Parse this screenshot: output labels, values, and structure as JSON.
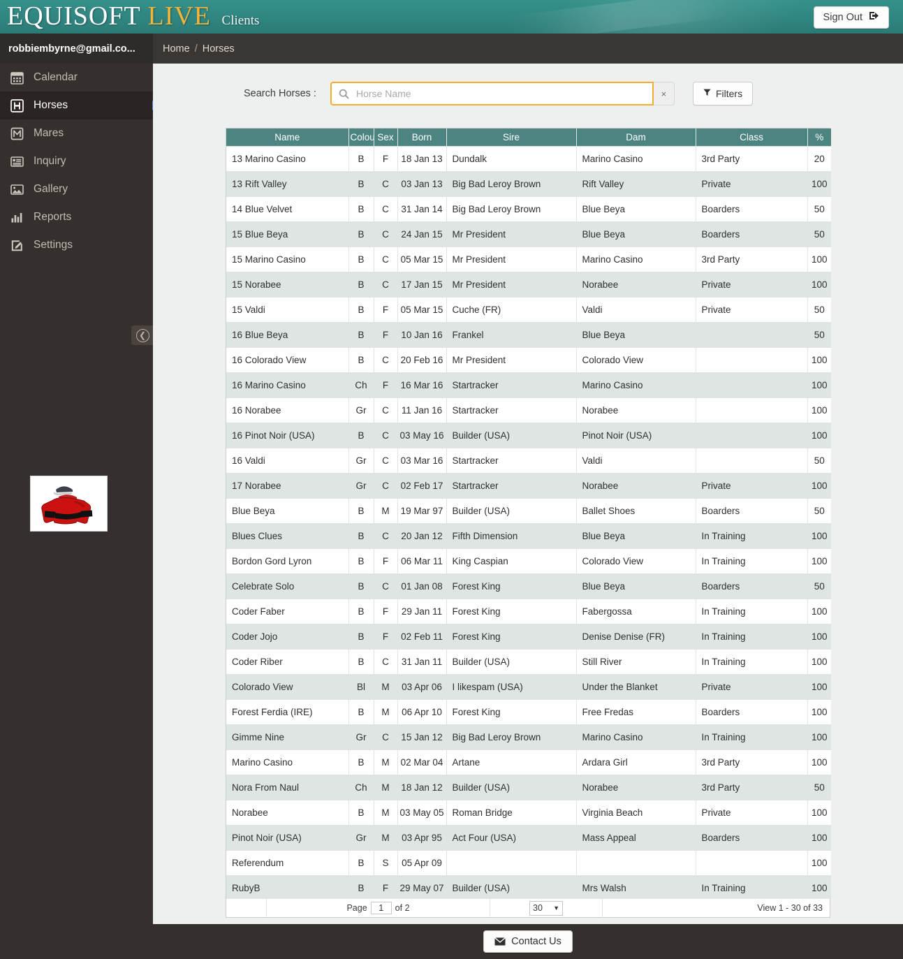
{
  "brand": {
    "name_1": "EQUISOFT",
    "name_2": "LIVE",
    "suffix": "Clients",
    "sign_out_label": "Sign Out",
    "teal": "#2f847f",
    "gold": "#f0b53c"
  },
  "user": {
    "email": "robbiembyrne@gmail.co..."
  },
  "breadcrumb": {
    "home": "Home",
    "separator": "/",
    "current": "Horses"
  },
  "sidebar": {
    "items": [
      {
        "label": "Calendar",
        "icon": "calendar-icon",
        "active": false
      },
      {
        "label": "Horses",
        "icon": "horse-icon",
        "active": true
      },
      {
        "label": "Mares",
        "icon": "mare-icon",
        "active": false
      },
      {
        "label": "Inquiry",
        "icon": "list-icon",
        "active": false
      },
      {
        "label": "Gallery",
        "icon": "image-icon",
        "active": false
      },
      {
        "label": "Reports",
        "icon": "bar-chart-icon",
        "active": false
      },
      {
        "label": "Settings",
        "icon": "edit-icon",
        "active": false
      }
    ],
    "collapse_icon": "chevron-left-circle-icon",
    "silks_alt": "racing-silks"
  },
  "search": {
    "label": "Search Horses :",
    "placeholder": "Horse Name",
    "value": "",
    "clear_label": "×",
    "filters_label": "Filters"
  },
  "table": {
    "columns": [
      "Name",
      "Colou",
      "Sex",
      "Born",
      "Sire",
      "Dam",
      "Class",
      "%"
    ],
    "rows": [
      [
        "13 Marino Casino",
        "B",
        "F",
        "18 Jan 13",
        "Dundalk",
        "Marino Casino",
        "3rd Party",
        "20"
      ],
      [
        "13 Rift Valley",
        "B",
        "C",
        "03 Jan 13",
        "Big Bad Leroy Brown",
        "Rift Valley",
        "Private",
        "100"
      ],
      [
        "14 Blue Velvet",
        "B",
        "C",
        "31 Jan 14",
        "Big Bad Leroy Brown",
        "Blue Beya",
        "Boarders",
        "50"
      ],
      [
        "15 Blue Beya",
        "B",
        "C",
        "24 Jan 15",
        "Mr President",
        "Blue Beya",
        "Boarders",
        "50"
      ],
      [
        "15 Marino Casino",
        "B",
        "C",
        "05 Mar 15",
        "Mr President",
        "Marino Casino",
        "3rd Party",
        "100"
      ],
      [
        "15 Norabee",
        "B",
        "C",
        "17 Jan 15",
        "Mr President",
        "Norabee",
        "Private",
        "100"
      ],
      [
        "15 Valdi",
        "B",
        "F",
        "05 Mar 15",
        "Cuche (FR)",
        "Valdi",
        "Private",
        "50"
      ],
      [
        "16 Blue Beya",
        "B",
        "F",
        "10 Jan 16",
        "Frankel",
        "Blue Beya",
        "",
        "50"
      ],
      [
        "16 Colorado View",
        "B",
        "C",
        "20 Feb 16",
        "Mr President",
        "Colorado View",
        "",
        "100"
      ],
      [
        "16 Marino Casino",
        "Ch",
        "F",
        "16 Mar 16",
        "Startracker",
        "Marino Casino",
        "",
        "100"
      ],
      [
        "16 Norabee",
        "Gr",
        "C",
        "11 Jan 16",
        "Startracker",
        "Norabee",
        "",
        "100"
      ],
      [
        "16 Pinot Noir (USA)",
        "B",
        "C",
        "03 May 16",
        "Builder (USA)",
        "Pinot Noir (USA)",
        "",
        "100"
      ],
      [
        "16 Valdi",
        "Gr",
        "C",
        "03 Mar 16",
        "Startracker",
        "Valdi",
        "",
        "50"
      ],
      [
        "17 Norabee",
        "Gr",
        "C",
        "02 Feb 17",
        "Startracker",
        "Norabee",
        "Private",
        "100"
      ],
      [
        "Blue Beya",
        "B",
        "M",
        "19 Mar 97",
        "Builder (USA)",
        "Ballet Shoes",
        "Boarders",
        "50"
      ],
      [
        "Blues Clues",
        "B",
        "C",
        "20 Jan 12",
        "Fifth Dimension",
        "Blue Beya",
        "In Training",
        "100"
      ],
      [
        "Bordon Gord Lyron",
        "B",
        "F",
        "06 Mar 11",
        "King Caspian",
        "Colorado View",
        "In Training",
        "100"
      ],
      [
        "Celebrate Solo",
        "B",
        "C",
        "01 Jan 08",
        "Forest King",
        "Blue Beya",
        "Boarders",
        "50"
      ],
      [
        "Coder Faber",
        "B",
        "F",
        "29 Jan 11",
        "Forest King",
        "Fabergossa",
        "In Training",
        "100"
      ],
      [
        "Coder Jojo",
        "B",
        "F",
        "02 Feb 11",
        "Forest King",
        "Denise Denise (FR)",
        "In Training",
        "100"
      ],
      [
        "Coder Riber",
        "B",
        "C",
        "31 Jan 11",
        "Builder (USA)",
        "Still River",
        "In Training",
        "100"
      ],
      [
        "Colorado View",
        "Bl",
        "M",
        "03 Apr 06",
        "I likespam (USA)",
        "Under the Blanket",
        "Private",
        "100"
      ],
      [
        "Forest Ferdia (IRE)",
        "B",
        "M",
        "06 Apr 10",
        "Forest King",
        "Free Fredas",
        "Boarders",
        "100"
      ],
      [
        "Gimme Nine",
        "Gr",
        "C",
        "15 Jan 12",
        "Big Bad Leroy Brown",
        "Marino Casino",
        "In Training",
        "100"
      ],
      [
        "Marino Casino",
        "B",
        "M",
        "02 Mar 04",
        "Artane",
        "Ardara Girl",
        "3rd Party",
        "100"
      ],
      [
        "Nora From Naul",
        "Ch",
        "M",
        "18 Jan 12",
        "Builder (USA)",
        "Norabee",
        "3rd Party",
        "50"
      ],
      [
        "Norabee",
        "B",
        "M",
        "03 May 05",
        "Roman Bridge",
        "Virginia Beach",
        "Private",
        "100"
      ],
      [
        "Pinot Noir (USA)",
        "Gr",
        "M",
        "03 Apr 95",
        "Act Four (USA)",
        "Mass Appeal",
        "Boarders",
        "100"
      ],
      [
        "Referendum",
        "B",
        "S",
        "05 Apr 09",
        "",
        "",
        "",
        "100"
      ],
      [
        "RubyB",
        "B",
        "F",
        "29 May 07",
        "Builder (USA)",
        "Mrs Walsh",
        "In Training",
        "100"
      ]
    ]
  },
  "pager": {
    "page_label": "Page",
    "page_value": "1",
    "of_label": "of 2",
    "page_size": "30",
    "view_label": "View 1 - 30 of 33"
  },
  "footer": {
    "contact_label": "Contact Us"
  }
}
